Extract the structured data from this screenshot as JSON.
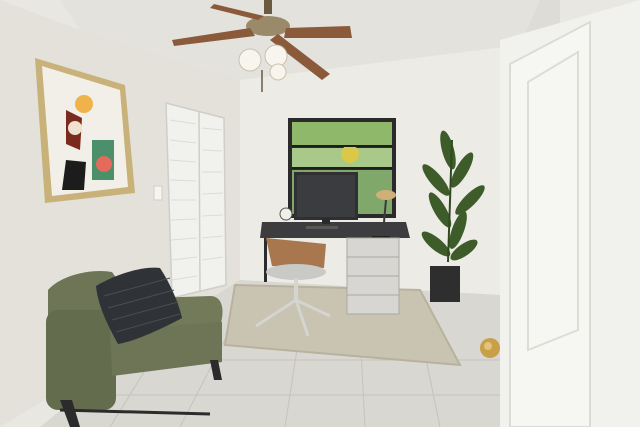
{
  "scene": {
    "description_free": true,
    "colors": {
      "ceiling": "#e4e2dc",
      "left_wall": "#e6e4de",
      "back_wall": "#ecebe6",
      "right_wall": "#e9e8e3",
      "floor_tile": "#d9d7d1",
      "grout": "#c6c3bb",
      "rug": "#c9c4b2",
      "chair_green": "#6d7556",
      "desk_top": "#3d3d3f",
      "drawer": "#d7d6d2",
      "plant_green": "#3e5c2a",
      "pot": "#2e2e2e",
      "door_white": "#f1f1ee",
      "knob_brass": "#c9a04a",
      "frame_gold": "#c8b27a",
      "fan_blade": "#8a5a3a"
    },
    "objects": [
      "ceiling-fan",
      "framed-art",
      "closet-bifold-door",
      "window",
      "desk",
      "computer-monitor",
      "desk-lamp",
      "office-chair",
      "drawer-cabinet",
      "potted-plant",
      "area-rug",
      "armchair",
      "throw-pillow",
      "door",
      "door-knob",
      "tile-floor"
    ]
  }
}
